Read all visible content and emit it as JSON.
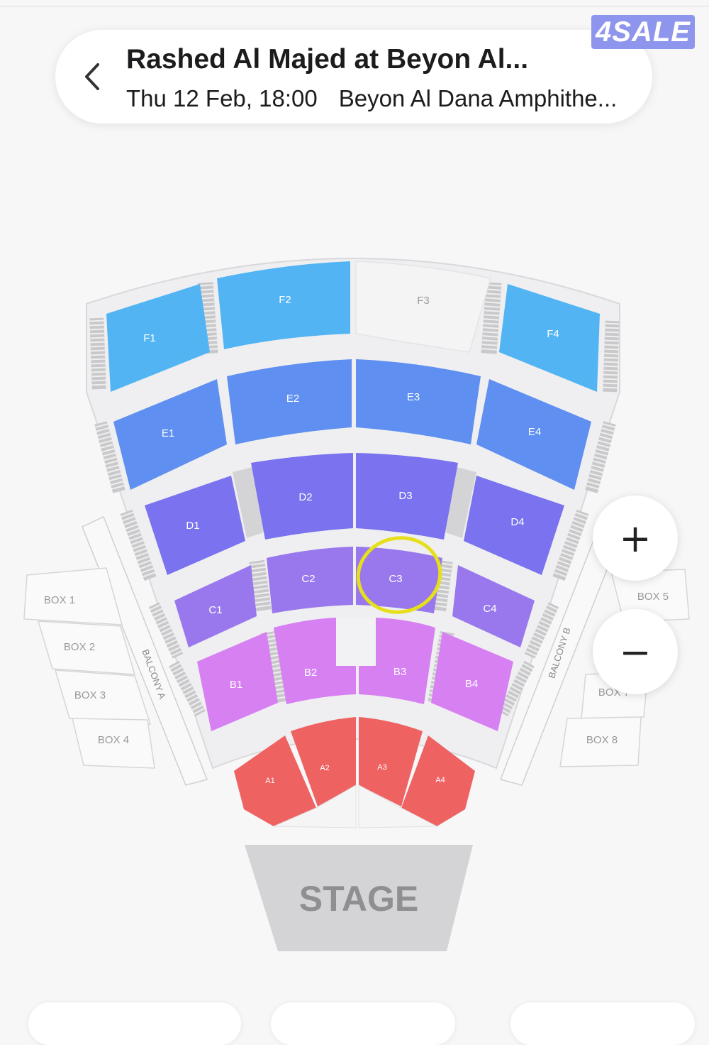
{
  "header": {
    "title": "Rashed Al Majed at Beyon Al...",
    "date": "Thu 12 Feb, 18:00",
    "venue": "Beyon Al Dana Amphithe..."
  },
  "brand": {
    "badge_label": "4SALE"
  },
  "icons": {
    "back": "chevron-left-icon",
    "zoom_in": "plus-icon",
    "zoom_out": "minus-icon"
  },
  "zoom": {
    "in_label": "+",
    "out_label": "−"
  },
  "colors": {
    "tier_f": "#52b4f3",
    "tier_e": "#5f8ff0",
    "tier_d": "#7a72ee",
    "tier_c": "#9878ec",
    "tier_b": "#d680f2",
    "tier_a": "#ee6262",
    "unavailable": "#f4f4f5",
    "stage": "#d4d4d6",
    "highlight": "#e6df1c"
  },
  "seat_map": {
    "sections": [
      {
        "id": "F1",
        "label": "F1",
        "tier": "tier_f"
      },
      {
        "id": "F2",
        "label": "F2",
        "tier": "tier_f"
      },
      {
        "id": "F3",
        "label": "F3",
        "tier": "unavailable"
      },
      {
        "id": "F4",
        "label": "F4",
        "tier": "tier_f"
      },
      {
        "id": "E1",
        "label": "E1",
        "tier": "tier_e"
      },
      {
        "id": "E2",
        "label": "E2",
        "tier": "tier_e"
      },
      {
        "id": "E3",
        "label": "E3",
        "tier": "tier_e"
      },
      {
        "id": "E4",
        "label": "E4",
        "tier": "tier_e"
      },
      {
        "id": "D1",
        "label": "D1",
        "tier": "tier_d"
      },
      {
        "id": "D2",
        "label": "D2",
        "tier": "tier_d"
      },
      {
        "id": "D3",
        "label": "D3",
        "tier": "tier_d"
      },
      {
        "id": "D4",
        "label": "D4",
        "tier": "tier_d"
      },
      {
        "id": "C1",
        "label": "C1",
        "tier": "tier_c"
      },
      {
        "id": "C2",
        "label": "C2",
        "tier": "tier_c"
      },
      {
        "id": "C3",
        "label": "C3",
        "tier": "tier_c",
        "highlighted": true
      },
      {
        "id": "C4",
        "label": "C4",
        "tier": "tier_c"
      },
      {
        "id": "B1",
        "label": "B1",
        "tier": "tier_b"
      },
      {
        "id": "B2",
        "label": "B2",
        "tier": "tier_b"
      },
      {
        "id": "B3",
        "label": "B3",
        "tier": "tier_b"
      },
      {
        "id": "B4",
        "label": "B4",
        "tier": "tier_b"
      },
      {
        "id": "A1",
        "label": "A1",
        "tier": "tier_a"
      },
      {
        "id": "A2",
        "label": "A2",
        "tier": "tier_a"
      },
      {
        "id": "A3",
        "label": "A3",
        "tier": "tier_a"
      },
      {
        "id": "A4",
        "label": "A4",
        "tier": "tier_a"
      }
    ],
    "boxes": [
      {
        "id": "box-1",
        "label": "BOX 1"
      },
      {
        "id": "box-2",
        "label": "BOX 2"
      },
      {
        "id": "box-3",
        "label": "BOX 3"
      },
      {
        "id": "box-4",
        "label": "BOX 4"
      },
      {
        "id": "box-5",
        "label": "BOX 5"
      },
      {
        "id": "box-7",
        "label": "BOX 7"
      },
      {
        "id": "box-8",
        "label": "BOX 8"
      }
    ],
    "balconies": [
      {
        "id": "balcony-a",
        "label": "BALCONY A"
      },
      {
        "id": "balcony-b",
        "label": "BALCONY B"
      }
    ],
    "stage_label": "STAGE"
  }
}
